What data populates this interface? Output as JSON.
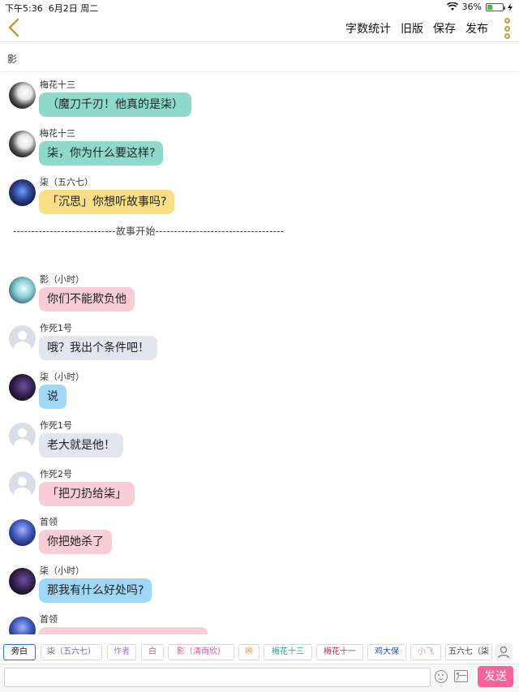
{
  "status_bar": {
    "time": "下午5:36",
    "date": "6月2日 周二",
    "battery": "36%",
    "battery_level": 0.36
  },
  "nav": {
    "actions": [
      "字数统计",
      "旧版",
      "保存",
      "发布"
    ],
    "accent_color": "#b9a13c"
  },
  "title": "影",
  "messages": [
    {
      "sender": "梅花十三",
      "text": "（魔刀千刃！他真的是柒）",
      "avatar": "ink-swordsman-avatar",
      "bubble_color": "#8fd9cb"
    },
    {
      "sender": "梅花十三",
      "text": "柒，你为什么要这样?",
      "avatar": "ink-swordsman-avatar",
      "bubble_color": "#8fd9cb"
    },
    {
      "sender": "柒（五六七）",
      "text": "「沉思」你想听故事吗?",
      "avatar": "blue-knight-avatar",
      "bubble_color": "#fbdf86"
    },
    {
      "sender": "影（小时）",
      "text": "你们不能欺负他",
      "avatar": "teal-child-avatar",
      "bubble_color": "#f8cdd6"
    },
    {
      "sender": "作死1号",
      "text": "哦？我出个条件吧！",
      "avatar": "default-avatar",
      "bubble_color": "#e1e6ef"
    },
    {
      "sender": "柒（小时）",
      "text": "说",
      "avatar": "dark-child-avatar",
      "bubble_color": "#9fd7f7"
    },
    {
      "sender": "作死1号",
      "text": "老大就是他！",
      "avatar": "default-avatar",
      "bubble_color": "#e1e6ef"
    },
    {
      "sender": "作死2号",
      "text": "「把刀扔给柒」",
      "avatar": "default-avatar",
      "bubble_color": "#f8cdd6"
    },
    {
      "sender": "首领",
      "text": "你把她杀了",
      "avatar": "leader-avatar",
      "bubble_color": "#f8cdd6"
    },
    {
      "sender": "柒（小时）",
      "text": "那我有什么好处吗?",
      "avatar": "dark-child-avatar",
      "bubble_color": "#9fd7f7"
    },
    {
      "sender": "首领",
      "text": "",
      "avatar": "leader-avatar",
      "bubble_color": "#f8cdd6"
    }
  ],
  "divider": "----------------------------故事开始-----------------------------------",
  "roles": [
    {
      "label": "旁白",
      "color": "#111111",
      "selected": true
    },
    {
      "label": "柒（五六七）",
      "color": "#7b5fc4"
    },
    {
      "label": "作者",
      "color": "#a674cc"
    },
    {
      "label": "白",
      "color": "#e05a5a"
    },
    {
      "label": "影（清雨欣）",
      "color": "#d35b9a"
    },
    {
      "label": "映",
      "color": "#e8a35a"
    },
    {
      "label": "梅花十三",
      "color": "#2f9e9e"
    },
    {
      "label": "梅花十一",
      "color": "#c0305e"
    },
    {
      "label": "鸡大保",
      "color": "#2a4fa8"
    },
    {
      "label": "小飞",
      "color": "#d98ad6"
    },
    {
      "label": "五六七（柒",
      "color": "#444444"
    }
  ],
  "input": {
    "placeholder": "",
    "send_label": "发送",
    "send_color": "#f3659a"
  }
}
